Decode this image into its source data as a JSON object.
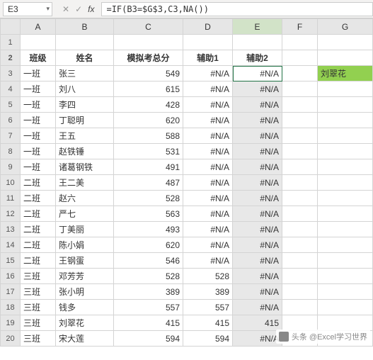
{
  "nameBox": "E3",
  "formula": "=IF(B3=$G$3,C3,NA())",
  "columns": [
    "A",
    "B",
    "C",
    "D",
    "E",
    "F",
    "G"
  ],
  "headerRow": {
    "A": "班级",
    "B": "姓名",
    "C": "模拟考总分",
    "D": "辅助1",
    "E": "辅助2",
    "F": "",
    "G": ""
  },
  "g3": "刘翠花",
  "rows": [
    {
      "r": 3,
      "A": "一班",
      "B": "张三",
      "C": "549",
      "D": "#N/A",
      "E": "#N/A"
    },
    {
      "r": 4,
      "A": "一班",
      "B": "刘八",
      "C": "615",
      "D": "#N/A",
      "E": "#N/A"
    },
    {
      "r": 5,
      "A": "一班",
      "B": "李四",
      "C": "428",
      "D": "#N/A",
      "E": "#N/A"
    },
    {
      "r": 6,
      "A": "一班",
      "B": "丁聪明",
      "C": "620",
      "D": "#N/A",
      "E": "#N/A"
    },
    {
      "r": 7,
      "A": "一班",
      "B": "王五",
      "C": "588",
      "D": "#N/A",
      "E": "#N/A"
    },
    {
      "r": 8,
      "A": "一班",
      "B": "赵铁锤",
      "C": "531",
      "D": "#N/A",
      "E": "#N/A"
    },
    {
      "r": 9,
      "A": "一班",
      "B": "诸葛钢铁",
      "C": "491",
      "D": "#N/A",
      "E": "#N/A"
    },
    {
      "r": 10,
      "A": "二班",
      "B": "王二美",
      "C": "487",
      "D": "#N/A",
      "E": "#N/A"
    },
    {
      "r": 11,
      "A": "二班",
      "B": "赵六",
      "C": "528",
      "D": "#N/A",
      "E": "#N/A"
    },
    {
      "r": 12,
      "A": "二班",
      "B": "严七",
      "C": "563",
      "D": "#N/A",
      "E": "#N/A"
    },
    {
      "r": 13,
      "A": "二班",
      "B": "丁美丽",
      "C": "493",
      "D": "#N/A",
      "E": "#N/A"
    },
    {
      "r": 14,
      "A": "二班",
      "B": "陈小娟",
      "C": "620",
      "D": "#N/A",
      "E": "#N/A"
    },
    {
      "r": 15,
      "A": "二班",
      "B": "王钢蛋",
      "C": "546",
      "D": "#N/A",
      "E": "#N/A"
    },
    {
      "r": 16,
      "A": "三班",
      "B": "邓芳芳",
      "C": "528",
      "D": "528",
      "E": "#N/A"
    },
    {
      "r": 17,
      "A": "三班",
      "B": "张小明",
      "C": "389",
      "D": "389",
      "E": "#N/A"
    },
    {
      "r": 18,
      "A": "三班",
      "B": "钱多",
      "C": "557",
      "D": "557",
      "E": "#N/A"
    },
    {
      "r": 19,
      "A": "三班",
      "B": "刘翠花",
      "C": "415",
      "D": "415",
      "E": "415"
    },
    {
      "r": 20,
      "A": "三班",
      "B": "宋大莲",
      "C": "594",
      "D": "594",
      "E": "#N/A"
    }
  ],
  "watermark": "头条 @Excel学习世界",
  "icons": {
    "cancel": "✕",
    "enter": "✓",
    "fx": "fx",
    "dropdown": "▾"
  }
}
